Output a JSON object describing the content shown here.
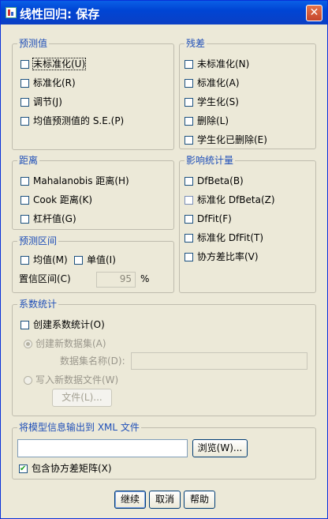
{
  "window": {
    "title": "线性回归: 保存"
  },
  "predicted": {
    "legend": "预测值",
    "items": [
      "未标准化(U)",
      "标准化(R)",
      "调节(J)",
      "均值预测值的 S.E.(P)"
    ]
  },
  "residuals": {
    "legend": "残差",
    "items": [
      "未标准化(N)",
      "标准化(A)",
      "学生化(S)",
      "删除(L)",
      "学生化已删除(E)"
    ]
  },
  "distances": {
    "legend": "距离",
    "items": [
      "Mahalanobis 距离(H)",
      "Cook 距离(K)",
      "杠杆值(G)"
    ]
  },
  "influence": {
    "legend": "影响统计量",
    "items": [
      "DfBeta(B)",
      "标准化 DfBeta(Z)",
      "DfFit(F)",
      "标准化 DfFit(T)",
      "协方差比率(V)"
    ]
  },
  "intervals": {
    "legend": "预测区间",
    "mean_label": "均值(M)",
    "individual_label": "单值(I)",
    "confidence_label": "置信区间(C)",
    "confidence_value": "95",
    "percent": "%"
  },
  "coef": {
    "legend": "系数统计",
    "create_label": "创建系数统计(O)",
    "new_dataset_label": "创建新数据集(A)",
    "dataset_name_label": "数据集名称(D):",
    "write_file_label": "写入新数据文件(W)",
    "file_button": "文件(L)..."
  },
  "xml": {
    "legend": "将模型信息输出到 XML 文件",
    "path_value": "",
    "browse_button": "浏览(W)...",
    "include_cov_label": "包含协方差矩阵(X)"
  },
  "buttons": {
    "continue": "继续",
    "cancel": "取消",
    "help": "帮助"
  },
  "colors": {
    "title_bar": "#0045d4",
    "group_legend": "#1f4fb8",
    "dialog_bg": "#ece9d8"
  }
}
